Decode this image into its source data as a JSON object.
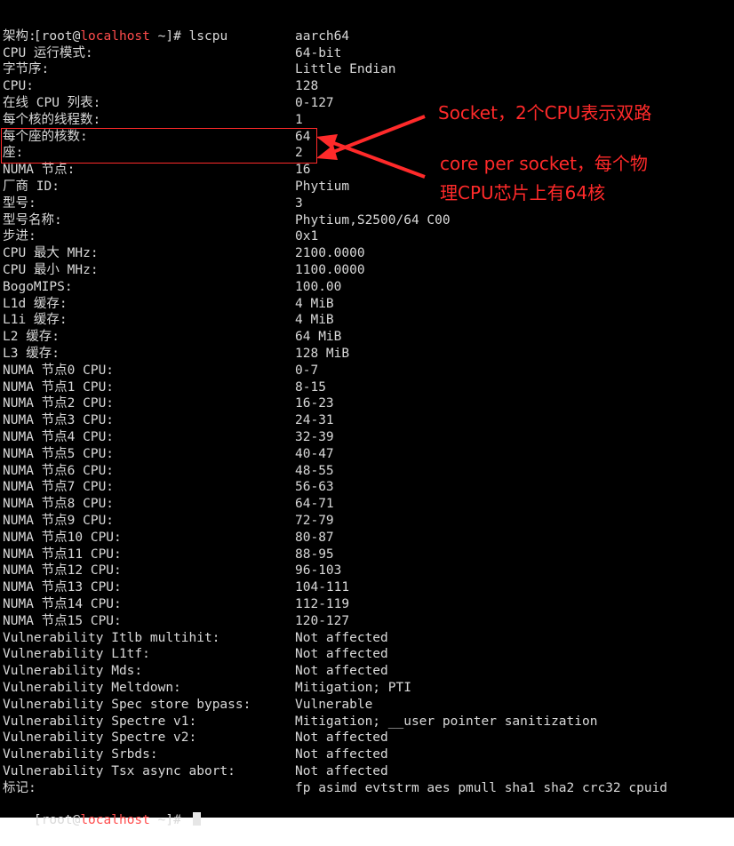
{
  "prompt": {
    "start": "[root@",
    "host": "localhost",
    "end": " ~]# ",
    "command": "lscpu",
    "final_end": " ~]# "
  },
  "rows": [
    {
      "key": "架构:",
      "value": "aarch64"
    },
    {
      "key": "CPU 运行模式:",
      "value": "64-bit"
    },
    {
      "key": "字节序:",
      "value": "Little Endian"
    },
    {
      "key": "CPU:",
      "value": "128"
    },
    {
      "key": "在线 CPU 列表:",
      "value": "0-127"
    },
    {
      "key": "每个核的线程数:",
      "value": "1"
    },
    {
      "key": "每个座的核数:",
      "value": "64"
    },
    {
      "key": "座:",
      "value": "2"
    },
    {
      "key": "NUMA 节点:",
      "value": "16"
    },
    {
      "key": "厂商 ID:",
      "value": "Phytium"
    },
    {
      "key": "型号:",
      "value": "3"
    },
    {
      "key": "型号名称:",
      "value": "Phytium,S2500/64 C00"
    },
    {
      "key": "步进:",
      "value": "0x1"
    },
    {
      "key": "CPU 最大 MHz:",
      "value": "2100.0000"
    },
    {
      "key": "CPU 最小 MHz:",
      "value": "1100.0000"
    },
    {
      "key": "BogoMIPS:",
      "value": "100.00"
    },
    {
      "key": "L1d 缓存:",
      "value": "4 MiB"
    },
    {
      "key": "L1i 缓存:",
      "value": "4 MiB"
    },
    {
      "key": "L2 缓存:",
      "value": "64 MiB"
    },
    {
      "key": "L3 缓存:",
      "value": "128 MiB"
    },
    {
      "key": "NUMA 节点0 CPU:",
      "value": "0-7"
    },
    {
      "key": "NUMA 节点1 CPU:",
      "value": "8-15"
    },
    {
      "key": "NUMA 节点2 CPU:",
      "value": "16-23"
    },
    {
      "key": "NUMA 节点3 CPU:",
      "value": "24-31"
    },
    {
      "key": "NUMA 节点4 CPU:",
      "value": "32-39"
    },
    {
      "key": "NUMA 节点5 CPU:",
      "value": "40-47"
    },
    {
      "key": "NUMA 节点6 CPU:",
      "value": "48-55"
    },
    {
      "key": "NUMA 节点7 CPU:",
      "value": "56-63"
    },
    {
      "key": "NUMA 节点8 CPU:",
      "value": "64-71"
    },
    {
      "key": "NUMA 节点9 CPU:",
      "value": "72-79"
    },
    {
      "key": "NUMA 节点10 CPU:",
      "value": "80-87"
    },
    {
      "key": "NUMA 节点11 CPU:",
      "value": "88-95"
    },
    {
      "key": "NUMA 节点12 CPU:",
      "value": "96-103"
    },
    {
      "key": "NUMA 节点13 CPU:",
      "value": "104-111"
    },
    {
      "key": "NUMA 节点14 CPU:",
      "value": "112-119"
    },
    {
      "key": "NUMA 节点15 CPU:",
      "value": "120-127"
    },
    {
      "key": "Vulnerability Itlb multihit:",
      "value": "Not affected"
    },
    {
      "key": "Vulnerability L1tf:",
      "value": "Not affected"
    },
    {
      "key": "Vulnerability Mds:",
      "value": "Not affected"
    },
    {
      "key": "Vulnerability Meltdown:",
      "value": "Mitigation; PTI"
    },
    {
      "key": "Vulnerability Spec store bypass:",
      "value": "Vulnerable"
    },
    {
      "key": "Vulnerability Spectre v1:",
      "value": "Mitigation; __user pointer sanitization"
    },
    {
      "key": "Vulnerability Spectre v2:",
      "value": "Not affected"
    },
    {
      "key": "Vulnerability Srbds:",
      "value": "Not affected"
    },
    {
      "key": "Vulnerability Tsx async abort:",
      "value": "Not affected"
    },
    {
      "key": "标记:",
      "value": "fp asimd evtstrm aes pmull sha1 sha2 crc32 cpuid"
    }
  ],
  "annotations": {
    "socket_note": "Socket，2个CPU表示双路",
    "core_note_line1": "core per socket，每个物",
    "core_note_line2": "理CPU芯片上有64核"
  },
  "colors": {
    "background": "#000000",
    "text": "#d9d9d9",
    "hostname": "#ff4c4c",
    "annotation": "#ff2a2a"
  }
}
